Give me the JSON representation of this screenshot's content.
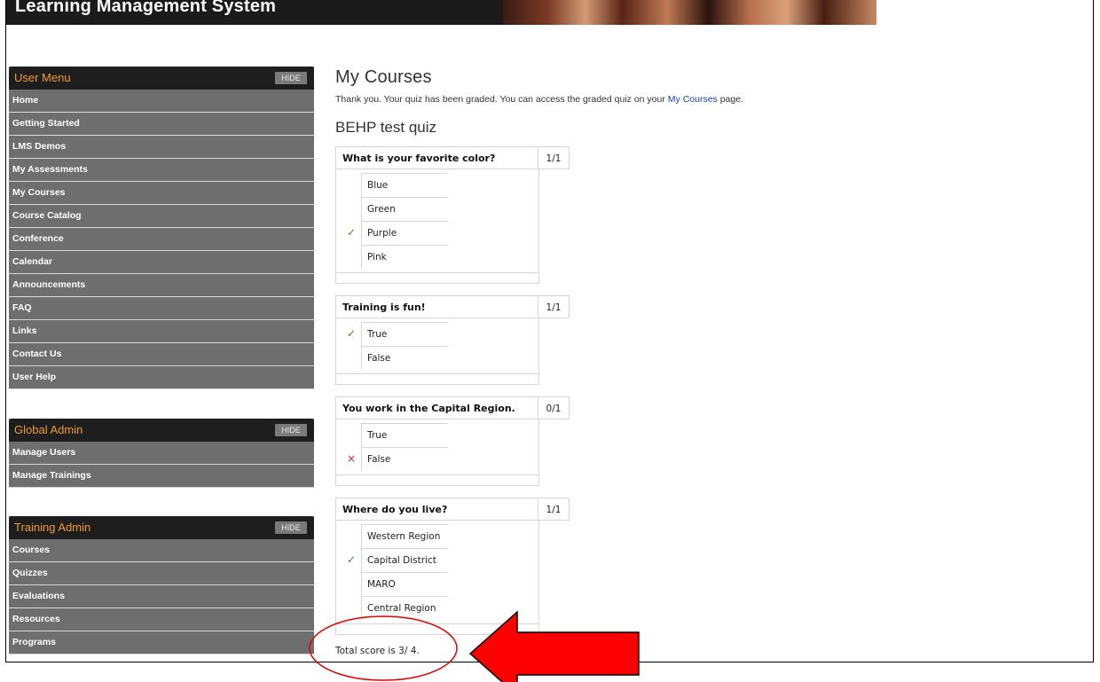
{
  "header": {
    "title": "Learning Management System"
  },
  "user_menu": {
    "title": "User Menu",
    "hide_label": "HIDE",
    "items": [
      "Home",
      "Getting Started",
      "LMS Demos",
      "My Assessments",
      "My Courses",
      "Course Catalog",
      "Conference",
      "Calendar",
      "Announcements",
      "FAQ",
      "Links",
      "Contact Us",
      "User Help"
    ]
  },
  "global_admin": {
    "title": "Global Admin",
    "hide_label": "HIDE",
    "items": [
      "Manage Users",
      "Manage Trainings"
    ]
  },
  "training_admin": {
    "title": "Training Admin",
    "hide_label": "HIDE",
    "items": [
      "Courses",
      "Quizzes",
      "Evaluations",
      "Resources",
      "Programs"
    ]
  },
  "main": {
    "title": "My Courses",
    "message_before": "Thank you. Your quiz has been graded. You can access the graded quiz on your ",
    "message_link": "My Courses",
    "message_after": " page.",
    "quiz_title": "BEHP test quiz",
    "questions": [
      {
        "text": "What is your favorite color?",
        "score": "1/1",
        "options": [
          {
            "label": "Blue",
            "mark": ""
          },
          {
            "label": "Green",
            "mark": ""
          },
          {
            "label": "Purple",
            "mark": "check"
          },
          {
            "label": "Pink",
            "mark": ""
          }
        ]
      },
      {
        "text": "Training is fun!",
        "score": "1/1",
        "options": [
          {
            "label": "True",
            "mark": "check"
          },
          {
            "label": "False",
            "mark": ""
          }
        ]
      },
      {
        "text": "You work in the Capital Region.",
        "score": "0/1",
        "options": [
          {
            "label": "True",
            "mark": ""
          },
          {
            "label": "False",
            "mark": "cross"
          }
        ]
      },
      {
        "text": "Where do you live?",
        "score": "1/1",
        "options": [
          {
            "label": "Western Region",
            "mark": ""
          },
          {
            "label": "Capital District",
            "mark": "check"
          },
          {
            "label": "MARO",
            "mark": ""
          },
          {
            "label": "Central Region",
            "mark": ""
          }
        ]
      }
    ],
    "total": "Total score is 3/ 4."
  },
  "icons": {
    "correct": "✓",
    "incorrect": "×"
  },
  "colors": {
    "menu_bg": "#6e6e6e",
    "menu_header_bg": "#1e1e1e",
    "menu_title": "#f29a2e",
    "link": "#1a3fb3",
    "annotation": "#e00000"
  }
}
